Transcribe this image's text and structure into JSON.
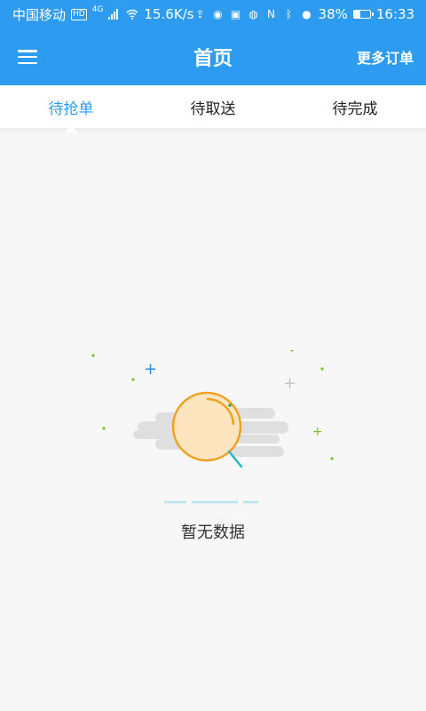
{
  "status_bar": {
    "carrier": "中国移动",
    "hd_badge": "HD",
    "network_type": "4G",
    "speed": "15.6K/s",
    "battery_percent": "38%",
    "time": "16:33",
    "battery_level": 0.38
  },
  "header": {
    "title": "首页",
    "more_orders_label": "更多订单"
  },
  "tabs": [
    {
      "label": "待抢单",
      "active": true
    },
    {
      "label": "待取送",
      "active": false
    },
    {
      "label": "待完成",
      "active": false
    }
  ],
  "empty_state": {
    "message": "暂无数据"
  },
  "colors": {
    "primary": "#2d9bf0",
    "active_tab": "#2d9bf0",
    "magnifier": "#f0a020",
    "cloud": "#dfdfdf"
  }
}
